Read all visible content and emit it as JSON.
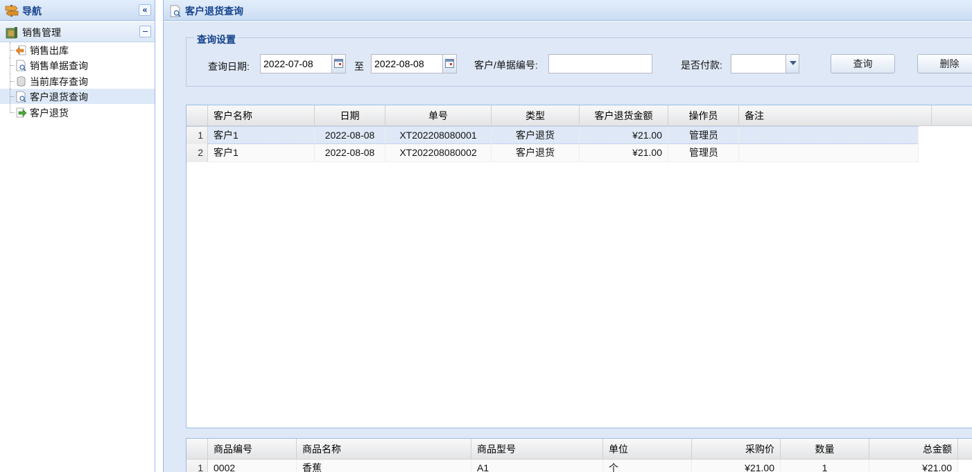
{
  "nav": {
    "title": "导航",
    "collapse_glyph": "«",
    "group": {
      "label": "销售管理"
    },
    "items": [
      {
        "label": "销售出库",
        "icon": "arrow-left-icon"
      },
      {
        "label": "销售单据查询",
        "icon": "document-search-icon"
      },
      {
        "label": "当前库存查询",
        "icon": "database-icon"
      },
      {
        "label": "客户退货查询",
        "icon": "document-search-icon",
        "selected": true
      },
      {
        "label": "客户退货",
        "icon": "arrow-right-icon"
      }
    ]
  },
  "main": {
    "title": "客户退货查询"
  },
  "query": {
    "legend": "查询设置",
    "date_label": "查询日期:",
    "date_from": "2022-07-08",
    "to_label": "至",
    "date_to": "2022-08-08",
    "customer_label": "客户/单据编号:",
    "customer_value": "",
    "paid_label": "是否付款:",
    "paid_value": "",
    "search_button": "查询",
    "delete_button": "删除"
  },
  "returns_grid": {
    "columns": [
      "客户名称",
      "日期",
      "单号",
      "类型",
      "客户退货金额",
      "操作员",
      "备注"
    ],
    "rows": [
      {
        "no": "1",
        "customer": "客户1",
        "date": "2022-08-08",
        "order_no": "XT202208080001",
        "type": "客户退货",
        "amount": "¥21.00",
        "operator": "管理员",
        "remark": ""
      },
      {
        "no": "2",
        "customer": "客户1",
        "date": "2022-08-08",
        "order_no": "XT202208080002",
        "type": "客户退货",
        "amount": "¥21.00",
        "operator": "管理员",
        "remark": ""
      }
    ]
  },
  "items_grid": {
    "columns": [
      "商品编号",
      "商品名称",
      "商品型号",
      "单位",
      "采购价",
      "数量",
      "总金额"
    ],
    "rows": [
      {
        "no": "1",
        "code": "0002",
        "name": "香蕉",
        "model": "A1",
        "unit": "个",
        "price": "¥21.00",
        "qty": "1",
        "total": "¥21.00"
      }
    ]
  }
}
